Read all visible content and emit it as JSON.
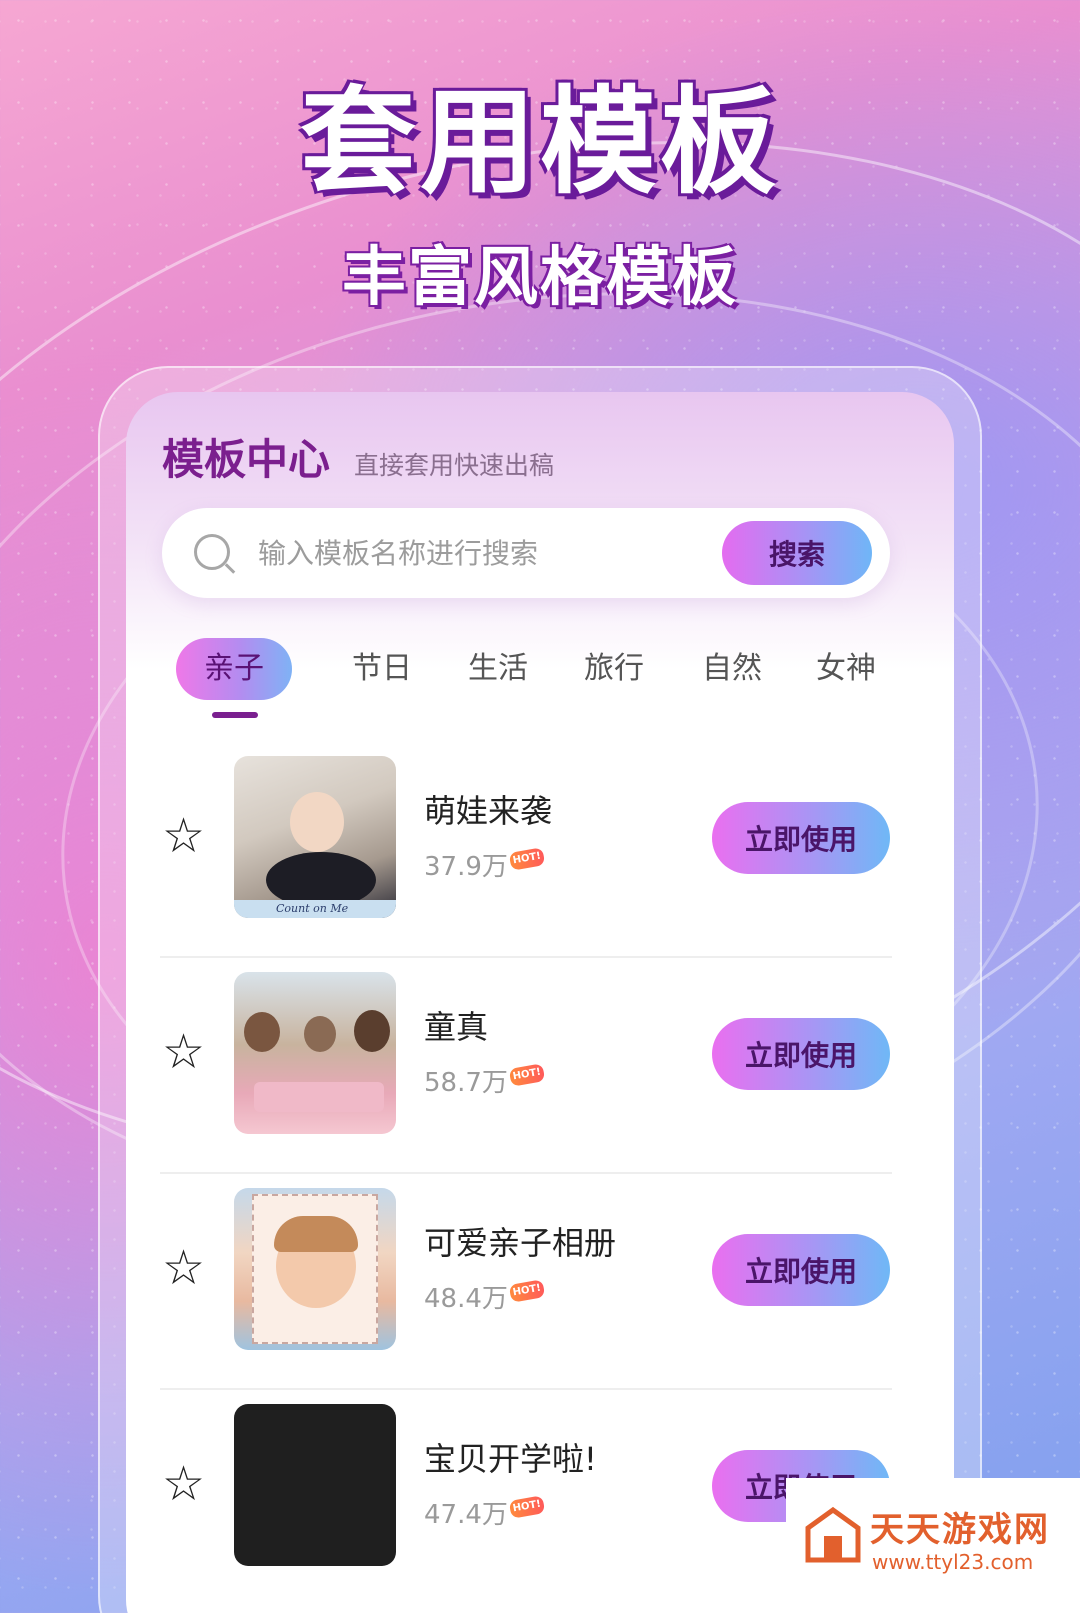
{
  "hero": {
    "title": "套用模板",
    "subtitle": "丰富风格模板"
  },
  "header": {
    "title": "模板中心",
    "subtitle": "直接套用快速出稿"
  },
  "search": {
    "placeholder": "输入模板名称进行搜索",
    "button_label": "搜索",
    "icon": "search-icon"
  },
  "tabs": [
    {
      "label": "亲子",
      "active": true
    },
    {
      "label": "节日",
      "active": false
    },
    {
      "label": "生活",
      "active": false
    },
    {
      "label": "旅行",
      "active": false
    },
    {
      "label": "自然",
      "active": false
    },
    {
      "label": "女神",
      "active": false
    }
  ],
  "templates": [
    {
      "title": "萌娃来袭",
      "count": "37.9万",
      "badge": "HOT!",
      "action": "立即使用",
      "thumb_caption": "Count on Me",
      "star_icon": "star-outline-icon"
    },
    {
      "title": "童真",
      "count": "58.7万",
      "badge": "HOT!",
      "action": "立即使用",
      "star_icon": "star-outline-icon"
    },
    {
      "title": "可爱亲子相册",
      "count": "48.4万",
      "badge": "HOT!",
      "action": "立即使用",
      "star_icon": "star-outline-icon"
    },
    {
      "title": "宝贝开学啦!",
      "count": "47.4万",
      "badge": "HOT!",
      "action": "立即使用",
      "star_icon": "star-outline-icon"
    }
  ],
  "watermark": {
    "name": "天天游戏网",
    "url": "www.ttyl23.com"
  },
  "colors": {
    "accent_purple": "#7b1f8e",
    "button_gradient_start": "#ea6ff0",
    "button_gradient_end": "#6fb8f6",
    "watermark_orange": "#e2602d"
  }
}
